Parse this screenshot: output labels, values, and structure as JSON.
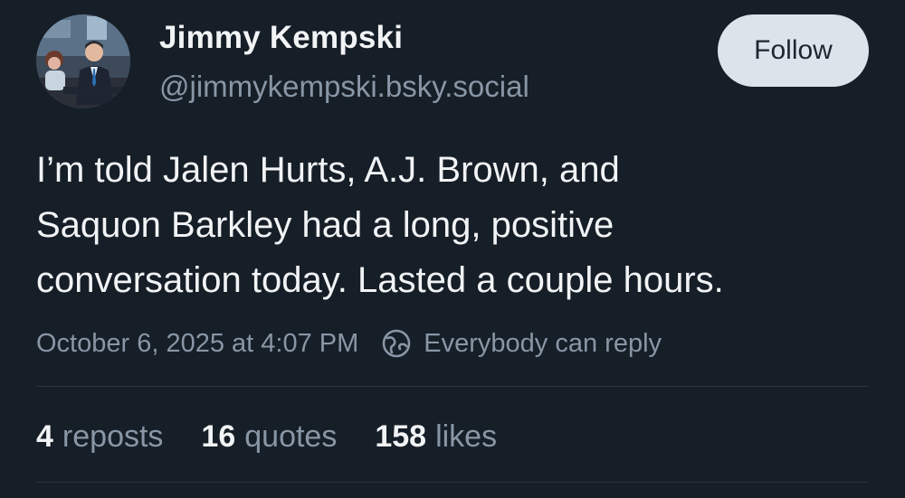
{
  "author": {
    "display_name": "Jimmy Kempski",
    "handle": "@jimmykempski.bsky.social"
  },
  "follow_label": "Follow",
  "post": {
    "text": "I’m told Jalen Hurts, A.J. Brown, and\nSaquon Barkley had a long, positive\nconversation today. Lasted a couple hours.",
    "timestamp": "October 6, 2025 at 4:07 PM",
    "reply_setting_icon": "globe-icon",
    "reply_setting": "Everybody can reply"
  },
  "stats": [
    {
      "count": "4",
      "label": "reposts"
    },
    {
      "count": "16",
      "label": "quotes"
    },
    {
      "count": "158",
      "label": "likes"
    }
  ],
  "colors": {
    "background": "#161e27",
    "primary_text": "#f1f3f5",
    "secondary_text": "#8896a5",
    "follow_button_bg": "#dce3ea",
    "divider": "#2b3642"
  }
}
